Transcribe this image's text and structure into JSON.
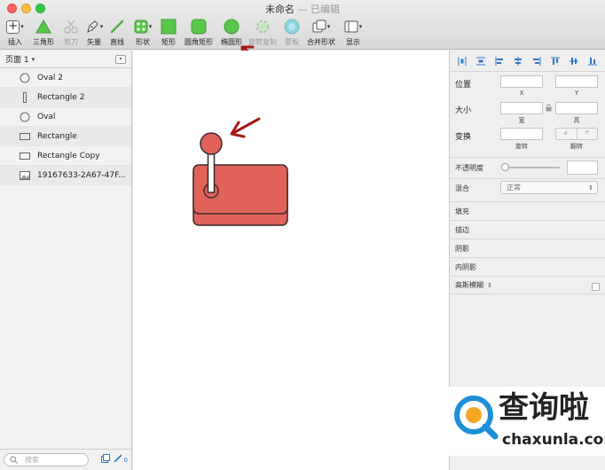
{
  "window": {
    "title": "未命名",
    "subtitle": "— 已编辑"
  },
  "toolbar": {
    "insert": "插入",
    "triangle": "三角形",
    "scissors": "剪刀",
    "vector": "矢量",
    "line": "直线",
    "shape": "形状",
    "rect": "矩形",
    "rounded_rect": "圆角矩形",
    "oval": "椭圆形",
    "rotate_copy": "旋转复制",
    "mask": "蒙板",
    "combine": "合并形状",
    "display": "显示"
  },
  "pages": {
    "selected": "页面 1"
  },
  "layers": [
    {
      "label": "Oval 2",
      "icon": "oval-icon"
    },
    {
      "label": "Rectangle 2",
      "icon": "rect-vertical-icon"
    },
    {
      "label": "Oval",
      "icon": "oval-icon"
    },
    {
      "label": "Rectangle",
      "icon": "rect-icon"
    },
    {
      "label": "Rectangle Copy",
      "icon": "rect-icon"
    },
    {
      "label": "19167633-2A67-47F...",
      "icon": "image-icon"
    }
  ],
  "search": {
    "placeholder": "搜索",
    "count": "0"
  },
  "inspector": {
    "position": "位置",
    "x": "X",
    "y": "Y",
    "size": "大小",
    "width": "宽",
    "height": "高",
    "transform": "变换",
    "rotate": "旋转",
    "flip": "翻转",
    "opacity": "不透明度",
    "blend": "混合",
    "blend_value": "正常",
    "fill": "填充",
    "border": "描边",
    "shadow": "阴影",
    "inner_shadow": "内阴影",
    "blur": "高斯模糊"
  },
  "watermark": {
    "cn": "查询啦",
    "url": "chaxunla.com"
  },
  "colors": {
    "shape_fill": "#e0625b",
    "shape_stroke": "#3b2a2a",
    "toolbar_green": "#58c74a",
    "arrow": "#a51a16",
    "watermark_blue": "#1e8fd6"
  }
}
